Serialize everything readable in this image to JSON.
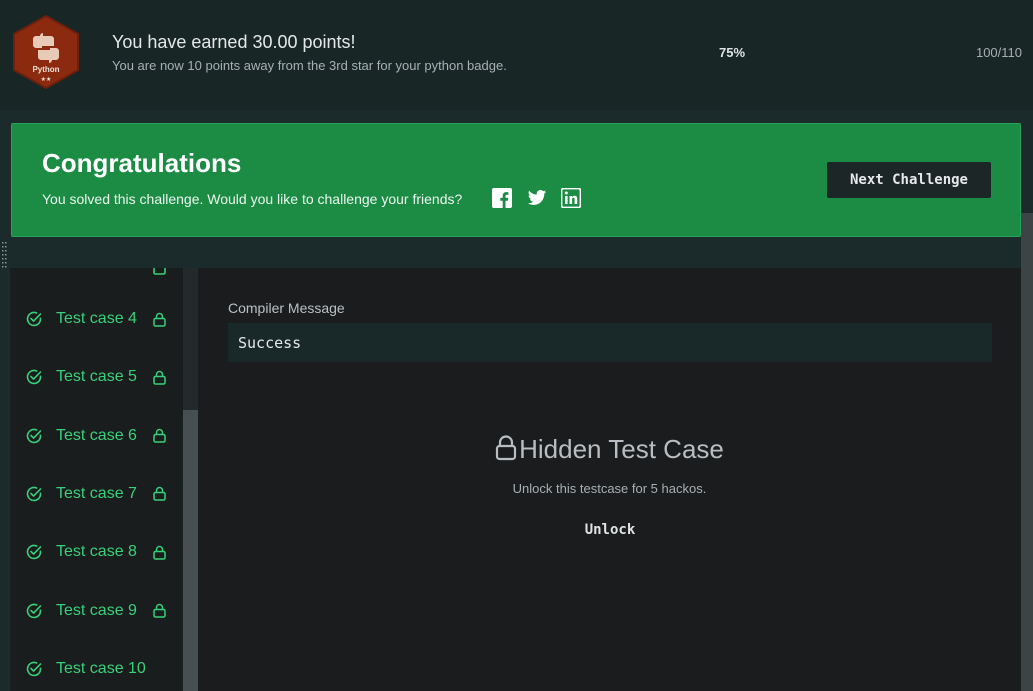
{
  "header": {
    "badge": {
      "label": "Python",
      "stars": "★★",
      "color": "#8c2a10"
    },
    "points_title": "You have earned 30.00 points!",
    "points_subtitle": "You are now 10 points away from the 3rd star for your python badge.",
    "progress_percent": "75%",
    "progress_count": "100/110"
  },
  "banner": {
    "title": "Congratulations",
    "text": "You solved this challenge. Would you like to challenge your friends?",
    "share_icons": [
      "facebook-icon",
      "twitter-icon",
      "linkedin-icon"
    ],
    "next_button": "Next Challenge",
    "color": "#1c8c45"
  },
  "sidebar": {
    "test_cases": [
      {
        "label": "Test case 4",
        "locked": true
      },
      {
        "label": "Test case 5",
        "locked": true
      },
      {
        "label": "Test case 6",
        "locked": true
      },
      {
        "label": "Test case 7",
        "locked": true
      },
      {
        "label": "Test case 8",
        "locked": true
      },
      {
        "label": "Test case 9",
        "locked": true
      },
      {
        "label": "Test case 10",
        "locked": false
      }
    ],
    "pass_color": "#39d07a"
  },
  "main": {
    "compiler_label": "Compiler Message",
    "compiler_message": "Success",
    "hidden_title": "Hidden Test Case",
    "hidden_subtitle": "Unlock this testcase for 5 hackos.",
    "unlock_button": "Unlock"
  }
}
